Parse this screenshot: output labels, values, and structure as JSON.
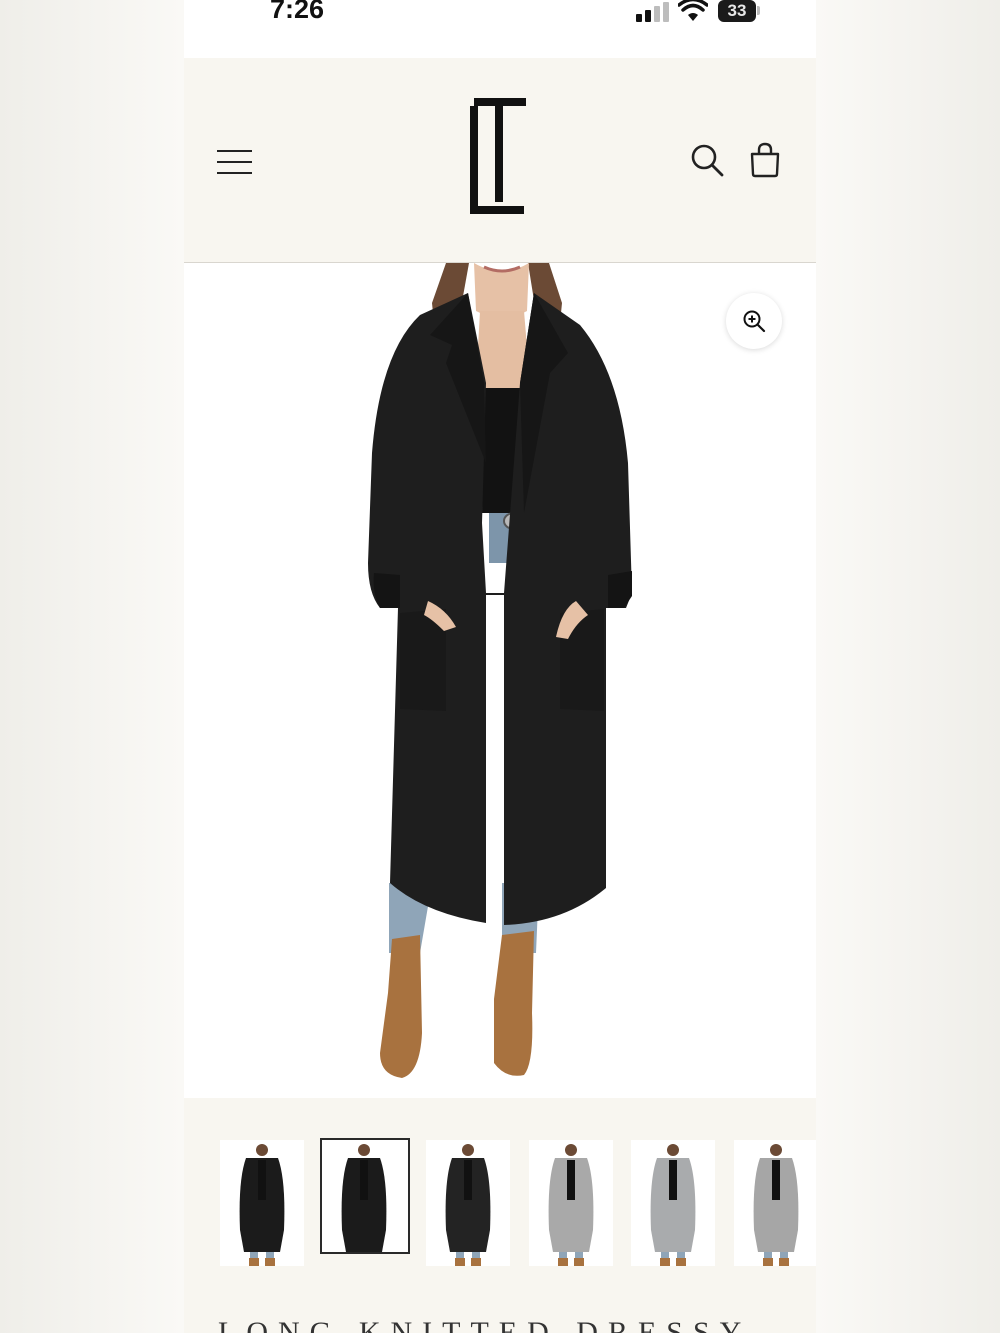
{
  "status_bar": {
    "time": "7:26",
    "battery": "33"
  },
  "header": {
    "menu_icon": "hamburger-menu-icon",
    "logo": "LT monogram logo",
    "search_icon": "search-icon",
    "bag_icon": "shopping-bag-icon"
  },
  "product": {
    "main_image": "woman wearing long black knitted coat with jeans and tan ankle boots",
    "zoom_icon": "zoom-in-icon",
    "title_partial": "LONG KNITTED DRESSY"
  },
  "thumbnails": [
    {
      "coat_color": "#1b1b1b",
      "active": false
    },
    {
      "coat_color": "#1b1b1b",
      "active": true
    },
    {
      "coat_color": "#232323",
      "active": false
    },
    {
      "coat_color": "#a9a9a9",
      "active": false
    },
    {
      "coat_color": "#a9abad",
      "active": false
    },
    {
      "coat_color": "#a6a6a6",
      "active": false
    }
  ],
  "colors": {
    "header_bg": "#f8f6f0",
    "ink": "#111111"
  }
}
